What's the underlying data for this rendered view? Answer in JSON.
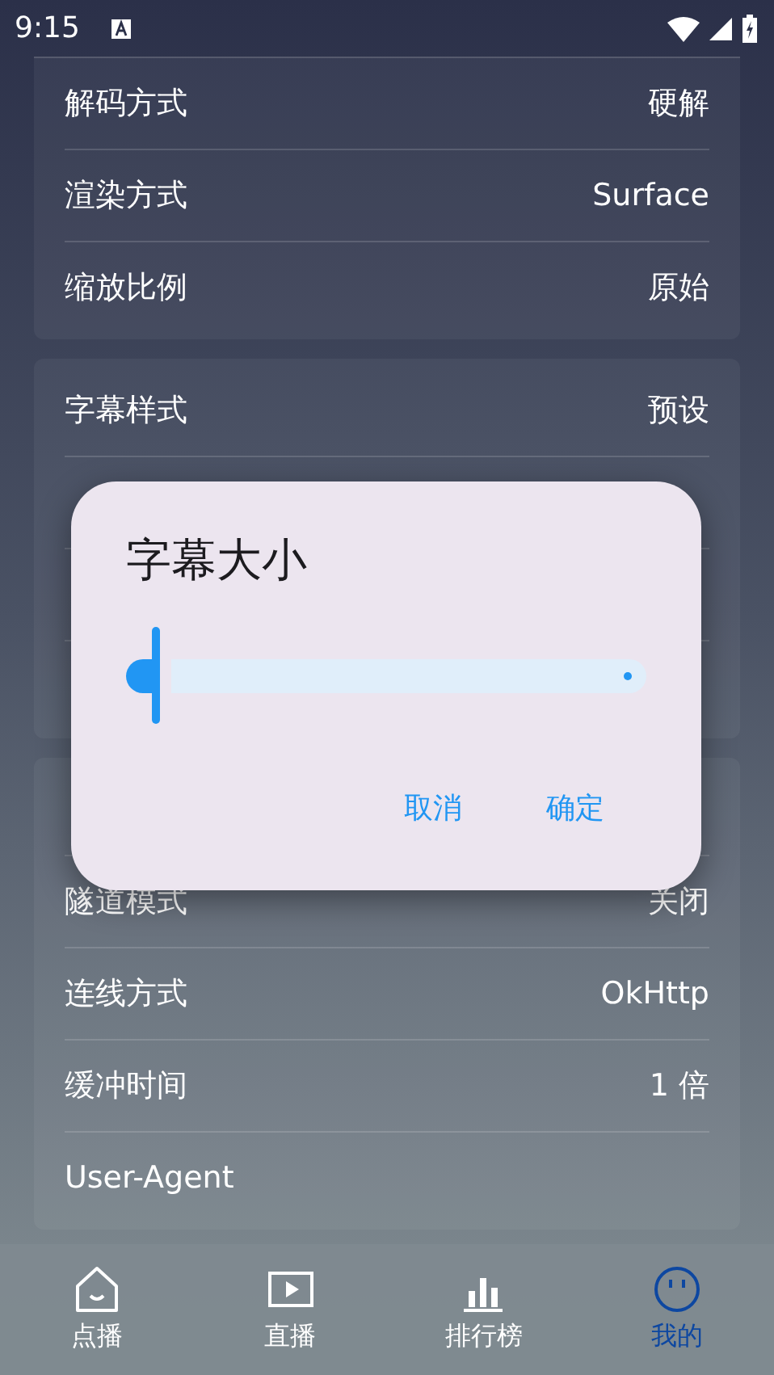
{
  "status_bar": {
    "time": "9:15"
  },
  "cards": [
    {
      "rows": [
        {
          "label": "解码方式",
          "value": "硬解"
        },
        {
          "label": "渲染方式",
          "value": "Surface"
        },
        {
          "label": "缩放比例",
          "value": "原始"
        }
      ]
    },
    {
      "rows": [
        {
          "label": "字幕样式",
          "value": "预设"
        },
        {
          "covered": true
        },
        {
          "covered": true
        },
        {
          "covered": true
        }
      ]
    },
    {
      "rows": [
        {
          "covered": true
        },
        {
          "label": "隧道模式",
          "value": "关闭"
        },
        {
          "label": "连线方式",
          "value": "OkHttp"
        },
        {
          "label": "缓冲时间",
          "value": "1 倍"
        },
        {
          "label": "User-Agent"
        }
      ]
    }
  ],
  "dialog": {
    "title": "字幕大小",
    "slider": {
      "level": 0
    },
    "buttons": [
      "取消",
      "确定"
    ]
  },
  "bottom_nav": [
    {
      "label": "点播",
      "kind": "home",
      "selected": false
    },
    {
      "label": "直播",
      "kind": "live",
      "selected": false
    },
    {
      "label": "排行榜",
      "kind": "chart",
      "selected": false
    },
    {
      "label": "我的",
      "kind": "me",
      "selected": true
    }
  ]
}
